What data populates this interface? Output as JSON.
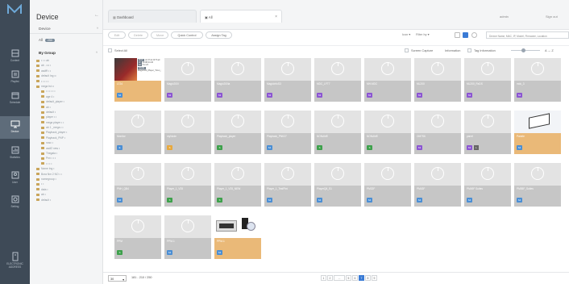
{
  "rail": [
    {
      "label": "Content",
      "icon": "content-icon"
    },
    {
      "label": "Playlist",
      "icon": "playlist-icon"
    },
    {
      "label": "Schedule",
      "icon": "schedule-icon"
    },
    {
      "label": "Device",
      "icon": "device-icon",
      "active": true
    },
    {
      "label": "Statistics",
      "icon": "statistics-icon"
    },
    {
      "label": "User",
      "icon": "user-icon"
    },
    {
      "label": "Setting",
      "icon": "setting-icon"
    },
    {
      "label": "ELECTRONIC",
      "label2": "ADDRESS",
      "icon": "electronic-address-icon"
    }
  ],
  "panel": {
    "title": "Device",
    "back": "←",
    "section": "Device",
    "section_toggle": "^",
    "all_label": "All",
    "all_count": "250",
    "group_label": "By Group",
    "group_toggle": "^",
    "tree": [
      "• • • ab",
      "ab . ••• •",
      "asdfff • •",
      "default Ing ••",
      "• • • • •",
      "mega tst ••",
      "• • • • • •",
      "age 4 •",
      "default_player •",
      "ab •",
      "default •",
      "player • •",
      "mega player • •",
      "ab 1 _mega • •",
      "Playback_player •",
      "Playback_PNP •",
      "ncsc •",
      "asdf2 new •",
      "Thegala •",
      "Pnn • • •",
      "• • • •",
      "Name Ing •",
      "Bora Nm 2 NO • •",
      "nomegroup •",
      "• •",
      "data •",
      "ab •",
      "default •"
    ]
  },
  "tabs": [
    {
      "label": "Dashboard",
      "icon": "dashboard-icon"
    },
    {
      "label": "All",
      "icon": "monitor-icon",
      "close": "×"
    }
  ],
  "header": {
    "user": "admin",
    "signout": "Sign out"
  },
  "toolbar": {
    "edit": "Edit",
    "delete": "Delete",
    "move": "Move",
    "quick_control": "Quick Control",
    "assign_tag": "Assign Tag",
    "icon_label": "Icon",
    "filter_by": "Filter by",
    "search_placeholder": "Device Name, MAC, IP, Model, Firmware, Location"
  },
  "subbar": {
    "select_all": "Select All",
    "screen_capture": "Screen Capture",
    "information": "Information",
    "tag_information": "Tag Information",
    "sort": "A → Z"
  },
  "devices": [
    {
      "name": "LT24",
      "badge": "S4",
      "color": "blue",
      "on": true,
      "thumb": "info"
    },
    {
      "name": "Magic200i",
      "badge": "S3",
      "color": "purple"
    },
    {
      "name": "Magic200ia",
      "badge": "S3",
      "color": "purple"
    },
    {
      "name": "MagicInfoS3",
      "badge": "S3",
      "color": "purple"
    },
    {
      "name": "MDC_LFT7",
      "badge": "S3",
      "color": "purple"
    },
    {
      "name": "MH-MDC",
      "badge": "S3",
      "color": "purple"
    },
    {
      "name": "ML200",
      "badge": "S3",
      "color": "purple"
    },
    {
      "name": "ML200_RxDS",
      "badge": "S3",
      "color": "purple"
    },
    {
      "name": "mdc_3",
      "badge": "S3",
      "color": "purple"
    },
    {
      "name": "Monitor",
      "badge": "E",
      "color": "blue"
    },
    {
      "name": "myNode",
      "badge": "S",
      "color": "orange"
    },
    {
      "name": "Playback_player",
      "badge": "S",
      "color": "green"
    },
    {
      "name": "Playback_PNK27",
      "badge": "S4",
      "color": "blue"
    },
    {
      "name": "NONAME",
      "badge": "S",
      "color": "green"
    },
    {
      "name": "NONAME",
      "badge": "S",
      "color": "green"
    },
    {
      "name": "OM7S6",
      "badge": "S3",
      "color": "purple"
    },
    {
      "name": "panel",
      "badge": "S3",
      "color": "purple",
      "badge2": "L"
    },
    {
      "name": "Panele",
      "badge": "S4",
      "color": "blue",
      "on": true,
      "thumb": "white"
    },
    {
      "name": "PNH_QB4",
      "badge": "S4",
      "color": "blue"
    },
    {
      "name": "Player_1_V25",
      "badge": "S",
      "color": "green"
    },
    {
      "name": "Player_1_V25_NEW",
      "badge": "S",
      "color": "green"
    },
    {
      "name": "Player_1_TestPlnt",
      "badge": "S4",
      "color": "blue"
    },
    {
      "name": "PlayerQ6_S1",
      "badge": "S4",
      "color": "blue"
    },
    {
      "name": "PM32F",
      "badge": "S4",
      "color": "blue"
    },
    {
      "name": "PM43F",
      "badge": "S4",
      "color": "blue"
    },
    {
      "name": "PM49F Suites",
      "badge": "S4",
      "color": "blue"
    },
    {
      "name": "PM55F_Suites",
      "badge": "S4",
      "color": "blue"
    },
    {
      "name": "PPM",
      "badge": "S",
      "color": "green"
    },
    {
      "name": "PPM-1",
      "badge": "S4",
      "color": "blue"
    },
    {
      "name": "PPM-1",
      "badge": "S4",
      "color": "blue",
      "on": true,
      "thumb": "collage"
    }
  ],
  "thumb_info": [
    "MAC:",
    "IP:",
    "ID:",
    "NAME:"
  ],
  "thumb_info_vals": [
    "dc:37:dc:0f:7f:a0",
    "10.88.44.40",
    "5.2.23",
    "Magic200i_Player_Tizen_2.0"
  ],
  "footer": {
    "page_size": "30",
    "range": "181 - 210 / 250",
    "pages": [
      "1",
      "2",
      "...",
      "5",
      "6",
      "7",
      "8",
      "9"
    ],
    "current": "7"
  },
  "colors": {
    "rail": "#3e4a57",
    "accent": "#3a7bd5",
    "selected_band": "#eab978",
    "band": "#c6c6c6"
  }
}
